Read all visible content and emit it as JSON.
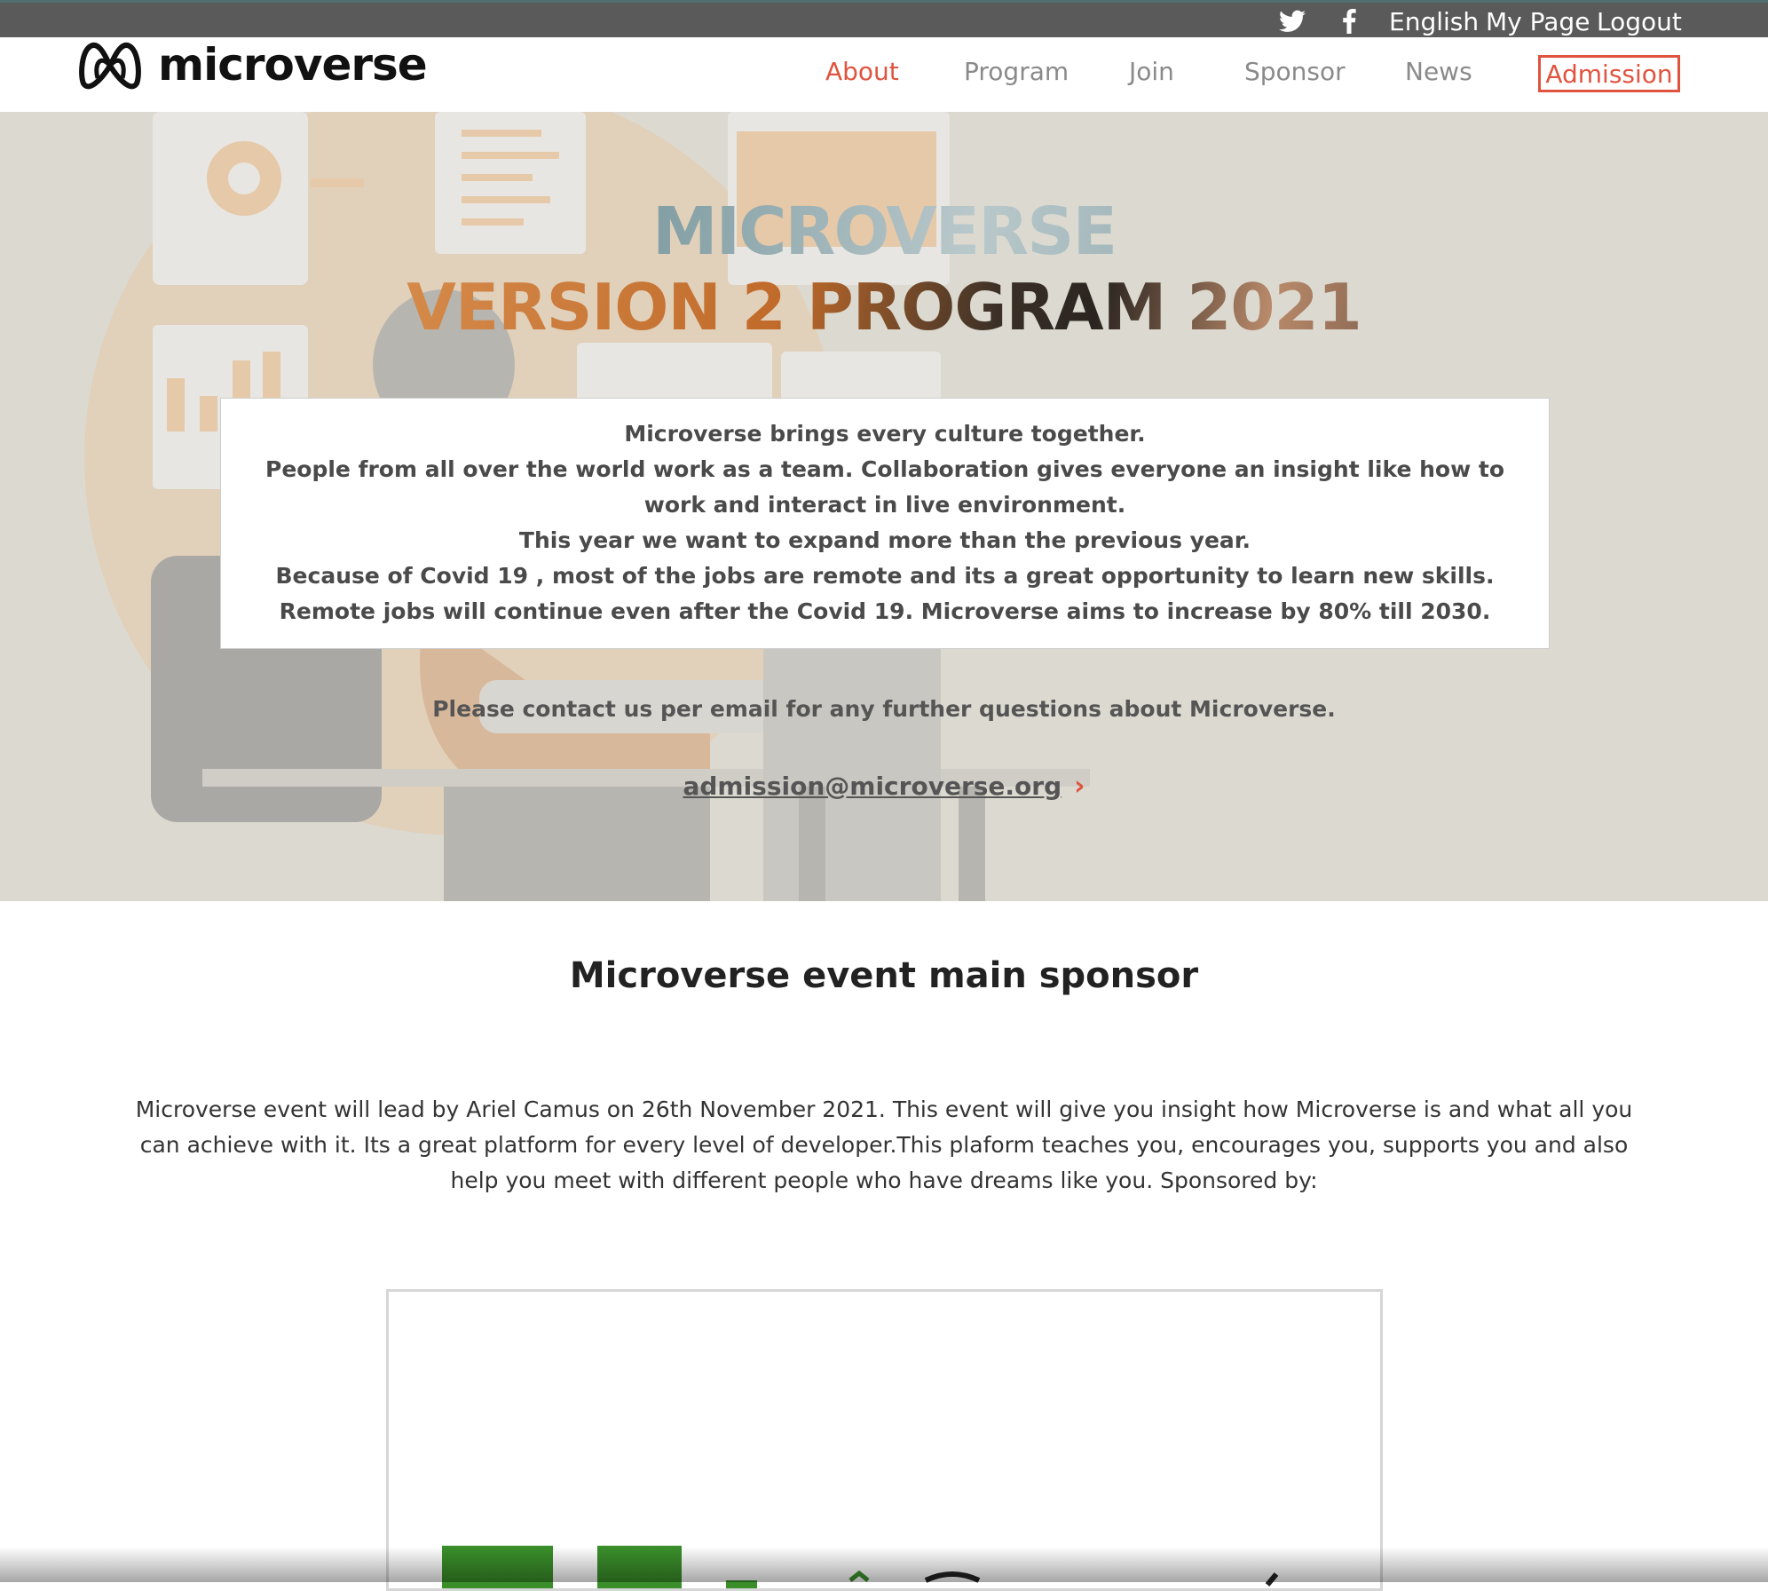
{
  "topbar": {
    "twitter_icon": "twitter-icon",
    "facebook_icon": "facebook-icon",
    "language": "English",
    "my_page": "My Page",
    "logout": "Logout"
  },
  "header": {
    "logo_text": "microverse",
    "nav": [
      "About",
      "Program",
      "Join",
      "Sponsor",
      "News"
    ],
    "active_nav": "About",
    "admission": "Admission"
  },
  "hero": {
    "title_line1": "MICROVERSE",
    "title_line2": "VERSION 2 PROGRAM 2021",
    "paragraphs": [
      "Microverse brings every culture together.",
      "People from all over the world work as a team. Collaboration gives everyone an insight like how to work and interact in live environment.",
      "This year we want to expand more than the previous year.",
      "Because of Covid 19 , most of the jobs are remote and its a great opportunity to learn new skills. Remote jobs will continue even after the Covid 19. Microverse aims to increase by 80% till 2030."
    ],
    "contact_text": "Please contact us per email for any further questions about Microverse.",
    "email": "admission@microverse.org",
    "email_arrow": "›"
  },
  "sponsor": {
    "title": "Microverse event main sponsor",
    "description": "Microverse event will lead by Ariel Camus on 26th November 2021. This event will give you insight how Microverse is and what all you can achieve with it. Its a great platform for every level of developer.This plaform teaches you, encourages you, supports you and also help you meet with different people who have dreams like you. Sponsored by:"
  },
  "colors": {
    "accent": "#e0533f",
    "topbar": "#5a5a5a",
    "hero_bg": "#dcdad0"
  }
}
